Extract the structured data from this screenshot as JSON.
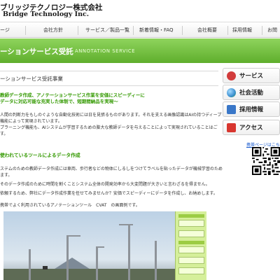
{
  "header": {
    "brand_ja": "ブリッジテクノロジー株式会社",
    "brand_en": "Bridge Technology Inc."
  },
  "nav": {
    "items": [
      "ージ",
      "会社方針",
      "サービス／製品一覧",
      "新着情報・FAQ",
      "会社概要",
      "採用情報",
      "お問"
    ]
  },
  "banner": {
    "title": "ーションサービス受託",
    "subtitle": "ANNOTATION SERVICE"
  },
  "main": {
    "heading": "ーションサービス受託事業",
    "lead_lines": [
      "教師データ作成、アノテーションサービス作業を安価にスピーディーに",
      "データに対応可能な充実した体制で、短期間納品を実現～"
    ],
    "para_lines": [
      "人間の判断力をもしのぐような自動化技術には日を見張るものがあります。それを支える画像認識はAIの持つディープ",
      "機能によって実現されています。",
      "プラーニング機能も、AIシステムが学習するための膨大な教師データを与えることによって実現されていることはご",
      "す。"
    ],
    "section_title": "使われているツールによるデータ作成",
    "body_lines": [
      "ステムのための教師データ作成には車両、歩行者などの物体にしるしをつけてラベルを貼ったデータが機械学習のため",
      "ます。",
      "そのデータ作成のために時間を割くことシステム全体の開発効率から大変問題が大きいと言わざるを得ません。",
      "依頼するため、弊社にデータ作成作業を任せてみませんか？安価でスピーディーにデータを作成し、お納めします。",
      "携帯でよく利用されているアノテーションツール　CVAT　の画面例です。"
    ]
  },
  "sidebar": {
    "buttons": [
      {
        "label": "サービス",
        "icon": "service-icon",
        "color": "#d23c3c"
      },
      {
        "label": "社会活動",
        "icon": "globe-icon",
        "color": "#3b8fd0"
      },
      {
        "label": "採用情報",
        "icon": "recruit-icon",
        "color": "#3977c8"
      },
      {
        "label": "アクセス",
        "icon": "access-icon",
        "color": "#d8362f"
      }
    ],
    "mobile_link": "携帯ページはこちら"
  },
  "colors": {
    "accent_green": "#5fae2c",
    "heading_green": "#339900",
    "panel_green": "#d5ef9a"
  }
}
